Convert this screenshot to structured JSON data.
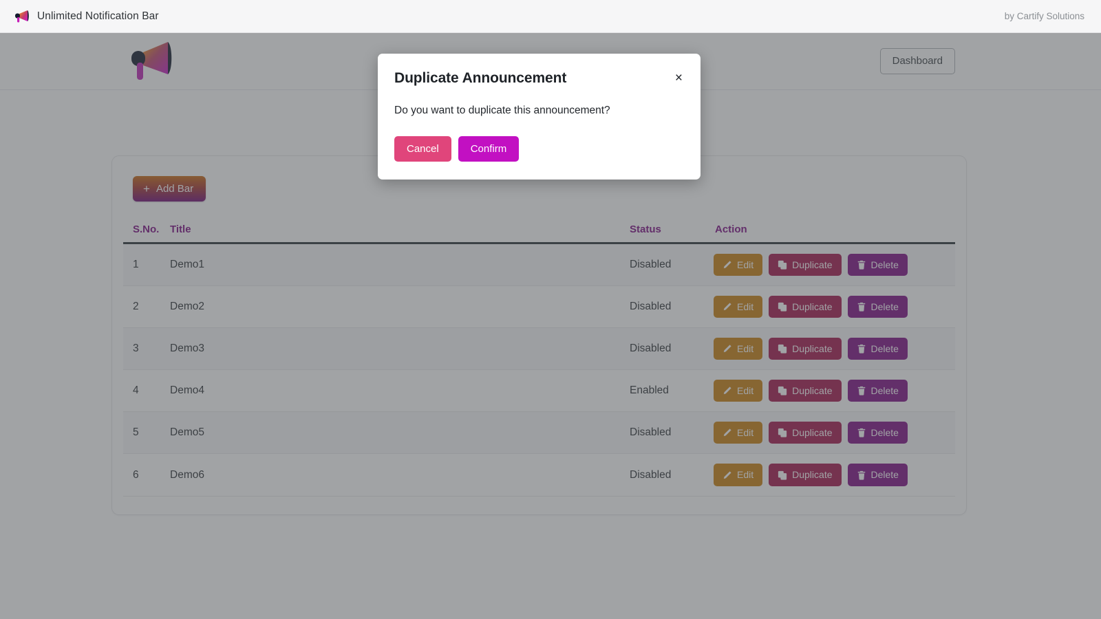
{
  "topbar": {
    "icon": "megaphone-icon",
    "title": "Unlimited Notification Bar",
    "credit": "by Cartify Solutions"
  },
  "navbar": {
    "logo": "megaphone-logo",
    "dashboard_label": "Dashboard"
  },
  "toolbar": {
    "add_bar_plus": "+",
    "add_bar_label": "Add Bar"
  },
  "table": {
    "columns": [
      "S.No.",
      "Title",
      "Status",
      "Action"
    ],
    "rows": [
      {
        "sno": "1",
        "title": "Demo1",
        "status": "Disabled"
      },
      {
        "sno": "2",
        "title": "Demo2",
        "status": "Disabled"
      },
      {
        "sno": "3",
        "title": "Demo3",
        "status": "Disabled"
      },
      {
        "sno": "4",
        "title": "Demo4",
        "status": "Enabled"
      },
      {
        "sno": "5",
        "title": "Demo5",
        "status": "Disabled"
      },
      {
        "sno": "6",
        "title": "Demo6",
        "status": "Disabled"
      }
    ],
    "actions": {
      "edit_label": "Edit",
      "duplicate_label": "Duplicate",
      "delete_label": "Delete",
      "edit_icon": "pencil-icon",
      "duplicate_icon": "copy-icon",
      "delete_icon": "trash-icon"
    }
  },
  "modal": {
    "title": "Duplicate Announcement",
    "close_glyph": "×",
    "body": "Do you want to duplicate this announcement?",
    "cancel_label": "Cancel",
    "confirm_label": "Confirm"
  },
  "colors": {
    "accent_purple": "#7d0d85",
    "accent_magenta": "#c210c2",
    "accent_pink": "#e0457b",
    "accent_orange": "#c98010",
    "accent_crimson": "#a4154b"
  }
}
